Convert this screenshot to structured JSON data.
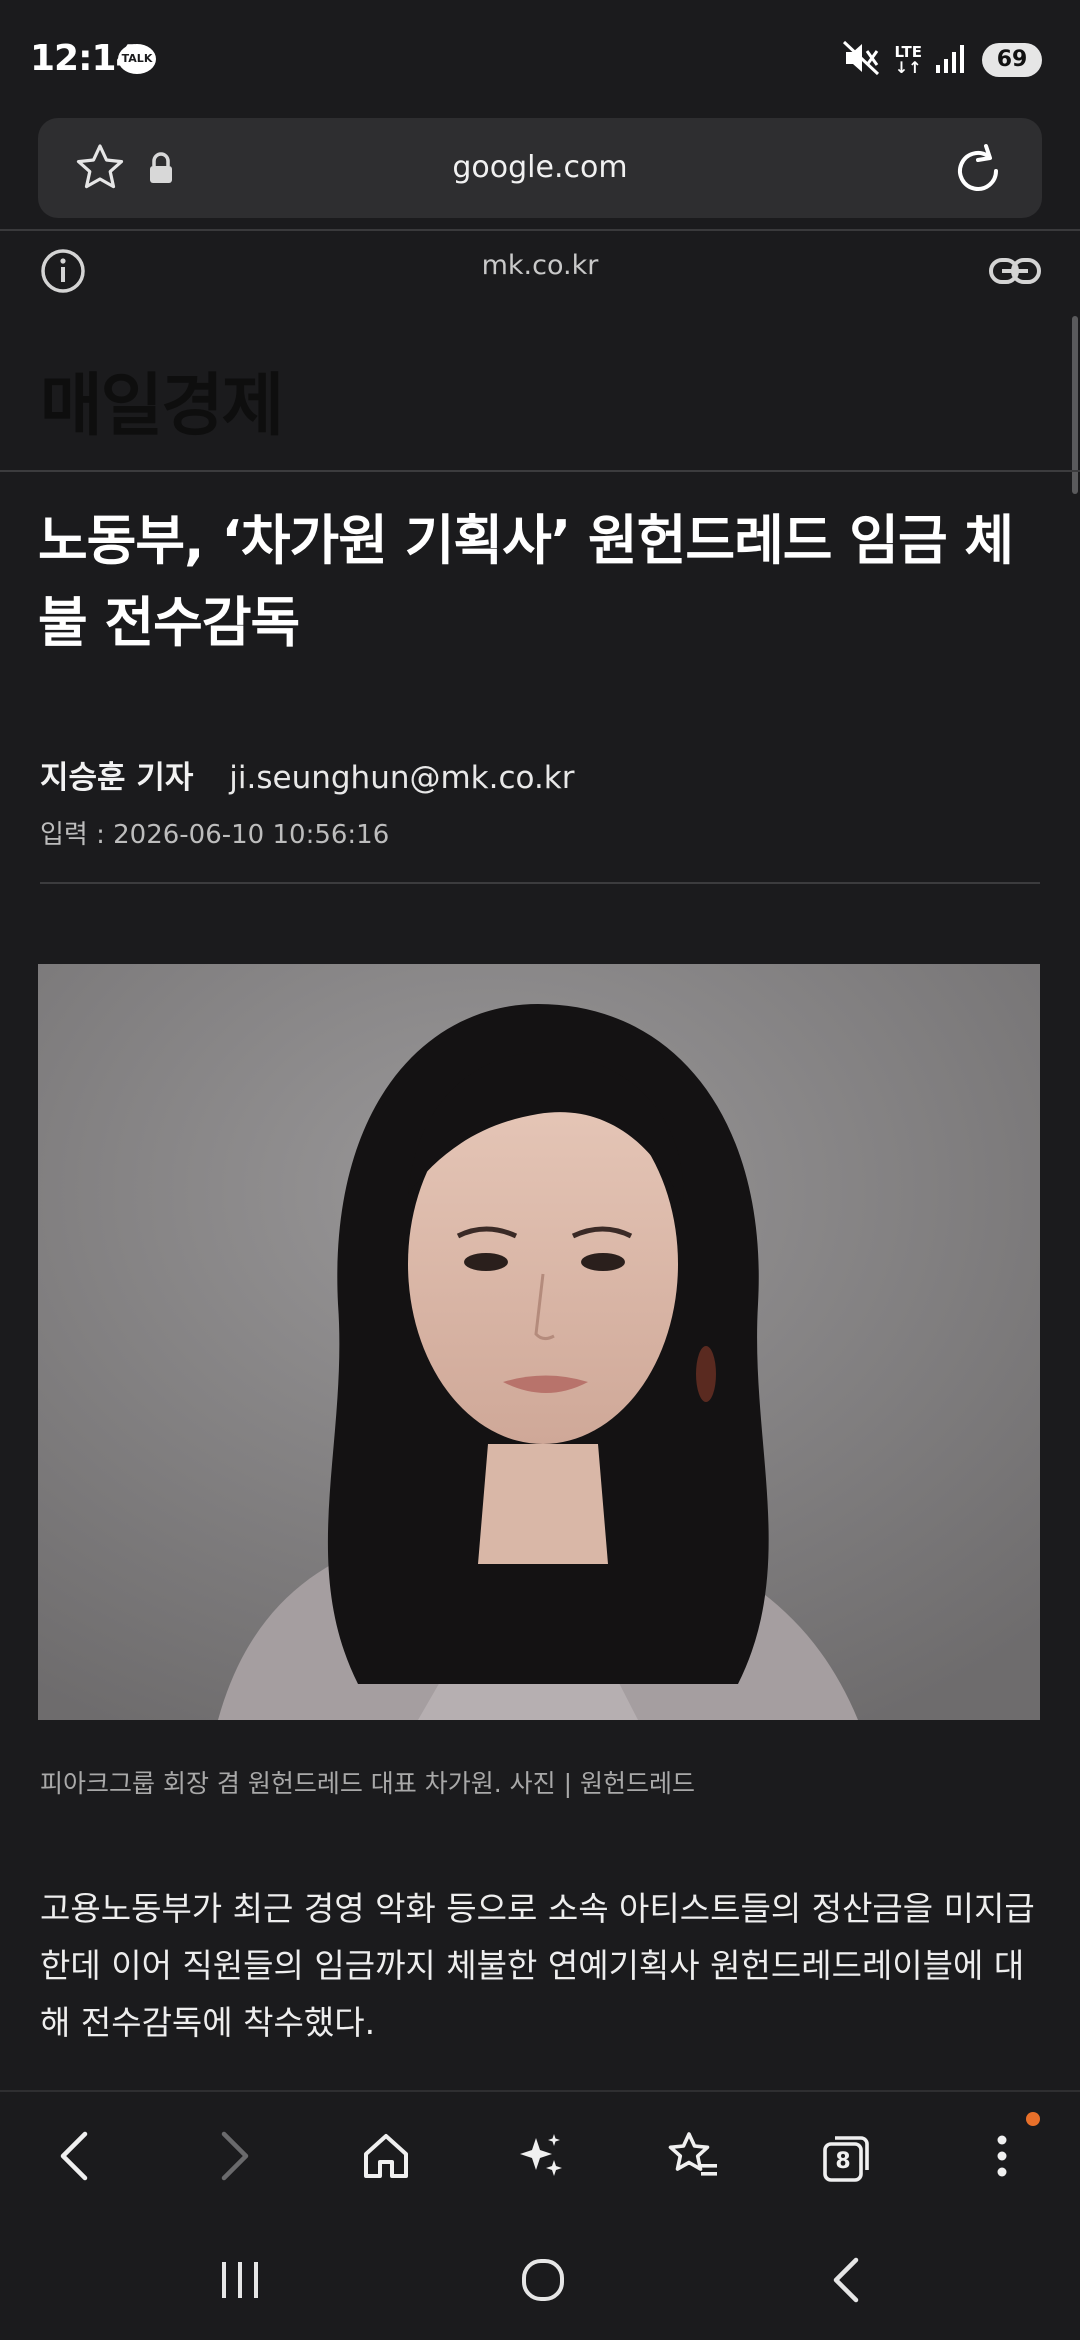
{
  "status_bar": {
    "time": "12:14",
    "talk": "TALK",
    "lte": "LTE",
    "battery": "69"
  },
  "browser": {
    "url": "google.com",
    "site": "mk.co.kr",
    "tab_count": "8"
  },
  "article": {
    "masthead": "매일경제",
    "headline": "노동부, ‘차가원 기획사’ 원헌드레드 임금 체불 전수감독",
    "author": "지승훈 기자",
    "email": "ji.seunghun@mk.co.kr",
    "date": "입력 : 2026-06-10 10:56:16",
    "caption": "피아크그룹 회장 겸 원헌드레드 대표 차가원. 사진 | 원헌드레드",
    "body": "고용노동부가 최근 경영 악화 등으로 소속 아티스트들의 정산금을 미지급 한데 이어 직원들의 임금까지 체불한 연예기획사 원헌드레드레이블에 대해 전수감독에 착수했다."
  },
  "colors": {
    "accent_dot": "#e8702a",
    "background": "#1b1b1d"
  }
}
